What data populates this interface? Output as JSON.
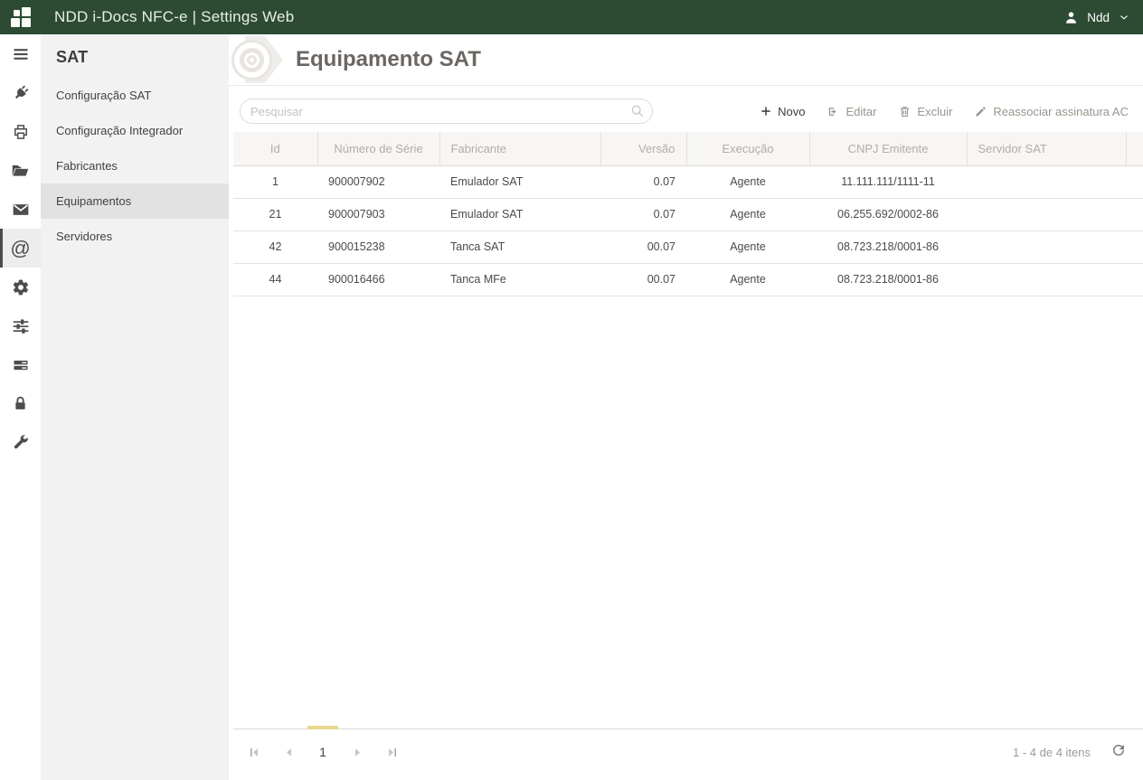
{
  "topbar": {
    "title": "NDD i-Docs NFC-e | Settings Web",
    "user": "Ndd"
  },
  "rail": {
    "icons": [
      "menu",
      "plug",
      "printer",
      "folder-open",
      "mail",
      "at",
      "gear",
      "sliders",
      "servers",
      "lock",
      "wrench"
    ],
    "active_icon": "at"
  },
  "sidebar": {
    "heading": "SAT",
    "items": [
      "Configuração SAT",
      "Configuração Integrador",
      "Fabricantes",
      "Equipamentos",
      "Servidores"
    ],
    "active_item": "Equipamentos"
  },
  "page": {
    "title": "Equipamento SAT"
  },
  "search": {
    "placeholder": "Pesquisar"
  },
  "toolbar": {
    "new": "Novo",
    "edit": "Editar",
    "delete": "Excluir",
    "reassign": "Reassociar assinatura AC"
  },
  "table": {
    "columns": [
      "Id",
      "Número de Série",
      "Fabricante",
      "Versão",
      "Execução",
      "CNPJ Emitente",
      "Servidor SAT"
    ],
    "rows": [
      [
        "1",
        "900007902",
        "Emulador SAT",
        "0.07",
        "Agente",
        "11.111.111/1111-11",
        ""
      ],
      [
        "21",
        "900007903",
        "Emulador SAT",
        "0.07",
        "Agente",
        "06.255.692/0002-86",
        ""
      ],
      [
        "42",
        "900015238",
        "Tanca SAT",
        "00.07",
        "Agente",
        "08.723.218/0001-86",
        ""
      ],
      [
        "44",
        "900016466",
        "Tanca MFe",
        "00.07",
        "Agente",
        "08.723.218/0001-86",
        ""
      ]
    ]
  },
  "pager": {
    "page": "1",
    "info": "1 - 4 de 4 itens"
  },
  "colors": {
    "topbar_green": "#2d4b33",
    "page_indicator": "#e9d78f",
    "grid_header_bg": "#f7f6f4"
  }
}
